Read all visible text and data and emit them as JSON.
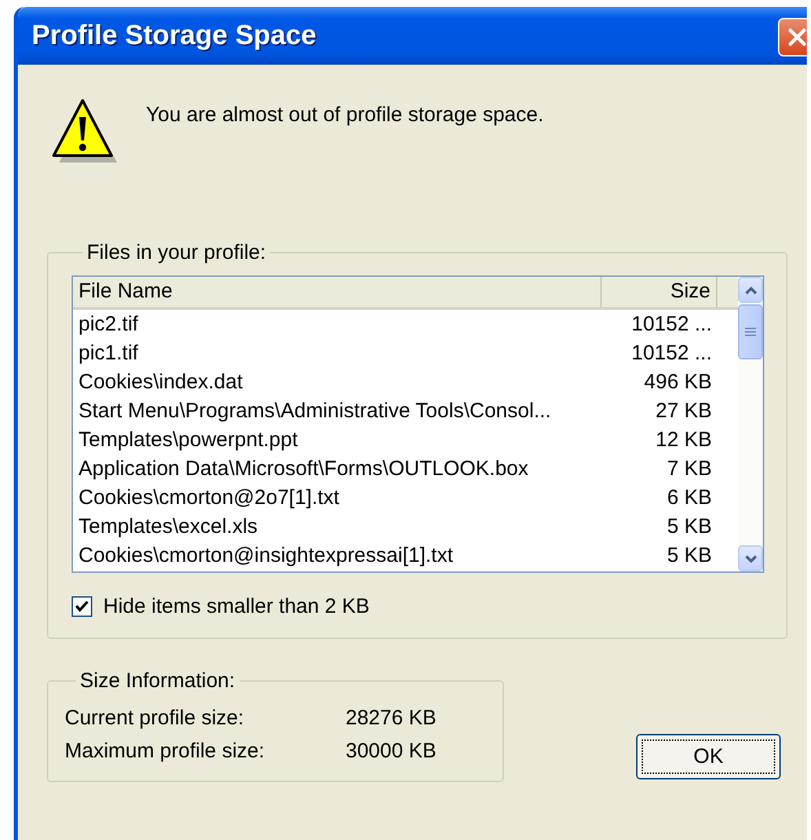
{
  "window": {
    "title": "Profile Storage Space"
  },
  "message": "You are almost out of profile storage space.",
  "files_group": {
    "label": "Files in your profile:",
    "columns": [
      "File Name",
      "Size"
    ],
    "rows": [
      {
        "name": "pic2.tif",
        "size": "10152 ..."
      },
      {
        "name": "pic1.tif",
        "size": "10152 ..."
      },
      {
        "name": "Cookies\\index.dat",
        "size": "496 KB"
      },
      {
        "name": "Start Menu\\Programs\\Administrative Tools\\Consol...",
        "size": "27 KB"
      },
      {
        "name": "Templates\\powerpnt.ppt",
        "size": "12 KB"
      },
      {
        "name": "Application Data\\Microsoft\\Forms\\OUTLOOK.box",
        "size": "7 KB"
      },
      {
        "name": "Cookies\\cmorton@2o7[1].txt",
        "size": "6 KB"
      },
      {
        "name": "Templates\\excel.xls",
        "size": "5 KB"
      },
      {
        "name": "Cookies\\cmorton@insightexpressai[1].txt",
        "size": "5 KB"
      }
    ],
    "hide_small": {
      "label": "Hide items smaller than 2 KB",
      "checked": true
    }
  },
  "size_group": {
    "label": "Size Information:",
    "rows": [
      {
        "label": "Current profile size:",
        "value": "28276 KB"
      },
      {
        "label": "Maximum profile size:",
        "value": "30000 KB"
      }
    ]
  },
  "buttons": [
    "OK"
  ]
}
